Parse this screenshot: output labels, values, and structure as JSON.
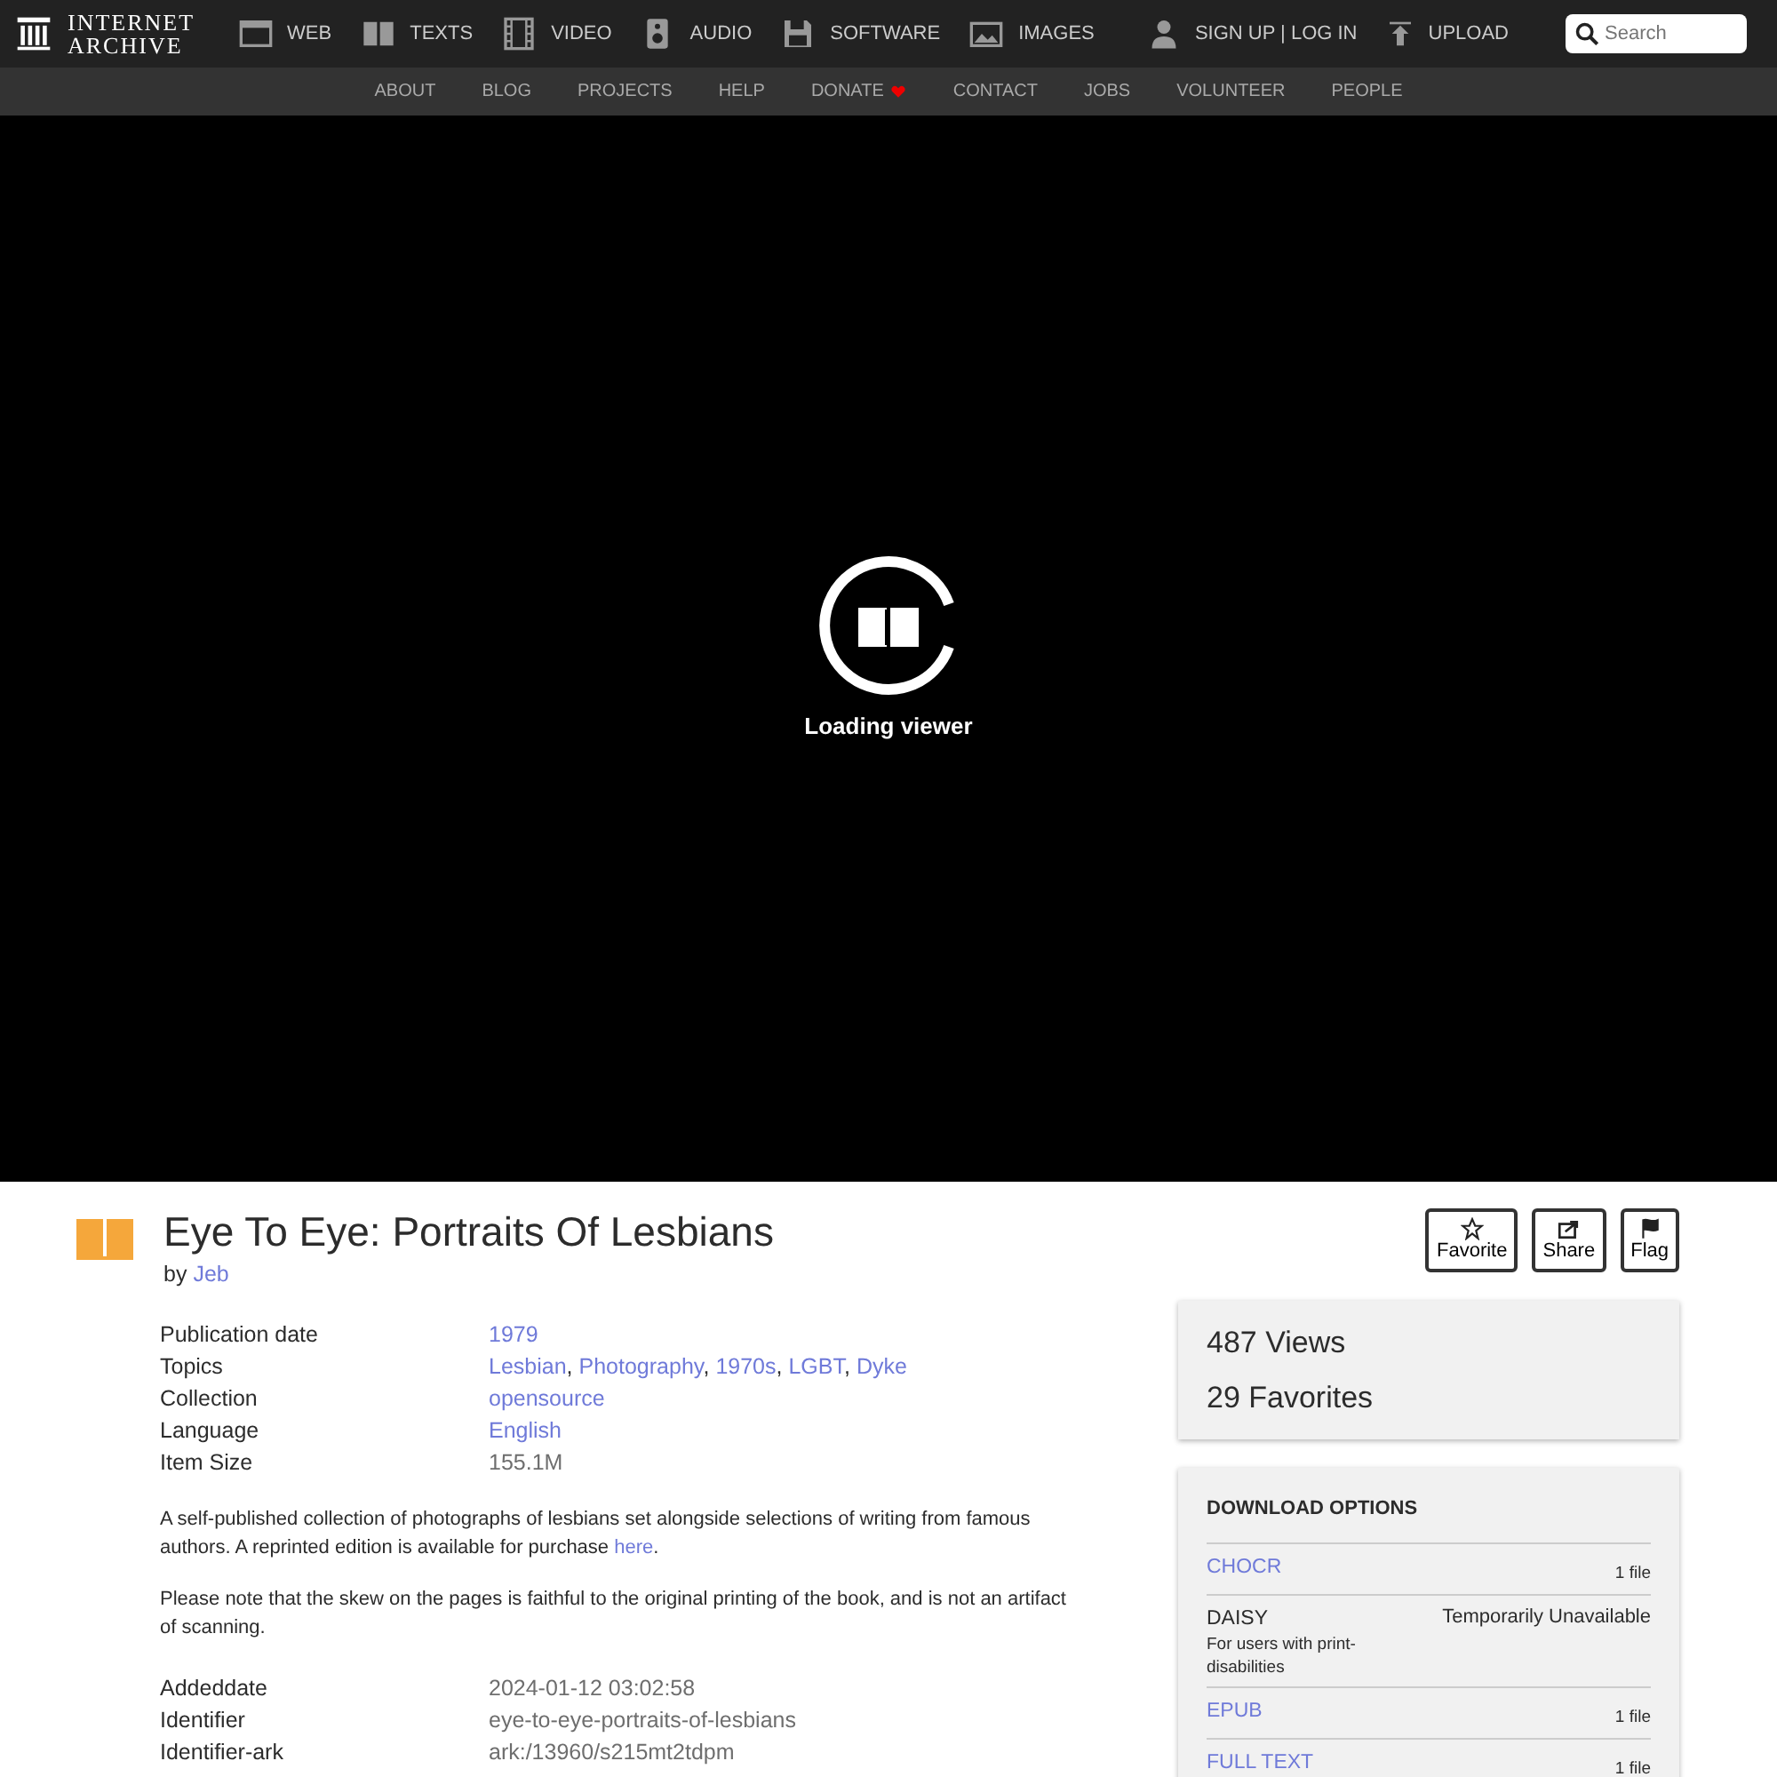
{
  "logo": {
    "line1": "INTERNET",
    "line2": "ARCHIVE"
  },
  "media_nav": [
    "WEB",
    "TEXTS",
    "VIDEO",
    "AUDIO",
    "SOFTWARE",
    "IMAGES"
  ],
  "account": {
    "signup": "SIGN UP | LOG IN",
    "upload": "UPLOAD"
  },
  "search": {
    "placeholder": "Search"
  },
  "sub_nav": [
    {
      "label": "ABOUT",
      "heart": false
    },
    {
      "label": "BLOG",
      "heart": false
    },
    {
      "label": "PROJECTS",
      "heart": false
    },
    {
      "label": "HELP",
      "heart": false
    },
    {
      "label": "DONATE",
      "heart": true
    },
    {
      "label": "CONTACT",
      "heart": false
    },
    {
      "label": "JOBS",
      "heart": false
    },
    {
      "label": "VOLUNTEER",
      "heart": false
    },
    {
      "label": "PEOPLE",
      "heart": false
    }
  ],
  "viewer": {
    "status": "Loading viewer"
  },
  "item": {
    "title": "Eye To Eye: Portraits Of Lesbians",
    "by": "by",
    "author": "Jeb"
  },
  "actions": [
    "Favorite",
    "Share",
    "Flag"
  ],
  "metadata": [
    {
      "label": "Publication date",
      "values": [
        {
          "text": "1979",
          "link": true
        }
      ]
    },
    {
      "label": "Topics",
      "separator": ",",
      "values": [
        {
          "text": "Lesbian",
          "link": true
        },
        {
          "text": "Photography",
          "link": true
        },
        {
          "text": "1970s",
          "link": true
        },
        {
          "text": "LGBT",
          "link": true
        },
        {
          "text": "Dyke",
          "link": true
        }
      ]
    },
    {
      "label": "Collection",
      "values": [
        {
          "text": "opensource",
          "link": true
        }
      ]
    },
    {
      "label": "Language",
      "values": [
        {
          "text": "English",
          "link": true
        }
      ]
    },
    {
      "label": "Item Size",
      "values": [
        {
          "text": "155.1M",
          "link": false
        }
      ]
    }
  ],
  "description": [
    {
      "text": "A self-published collection of photographs of lesbians set alongside selections of writing from famous authors. A reprinted edition is available for purchase ",
      "link": "here",
      "after": "."
    },
    {
      "text": "Please note that the skew on the pages is faithful to the original printing of the book, and is not an artifact of scanning."
    }
  ],
  "extra_metadata": [
    {
      "label": "Addeddate",
      "value": "2024-01-12 03:02:58"
    },
    {
      "label": "Identifier",
      "value": "eye-to-eye-portraits-of-lesbians"
    },
    {
      "label": "Identifier-ark",
      "value": "ark:/13960/s215mt2tdpm"
    }
  ],
  "stats": [
    "487 Views",
    "29 Favorites"
  ],
  "downloads": {
    "title": "DOWNLOAD OPTIONS",
    "rows": [
      {
        "name": "CHOCR",
        "available": true,
        "count": "1 file"
      },
      {
        "name": "DAISY",
        "available": false,
        "note": "For users with print-disabilities",
        "count": "Temporarily Unavailable"
      },
      {
        "name": "EPUB",
        "available": true,
        "count": "1 file"
      },
      {
        "name": "FULL TEXT",
        "available": true,
        "count": "1 file"
      }
    ]
  }
}
